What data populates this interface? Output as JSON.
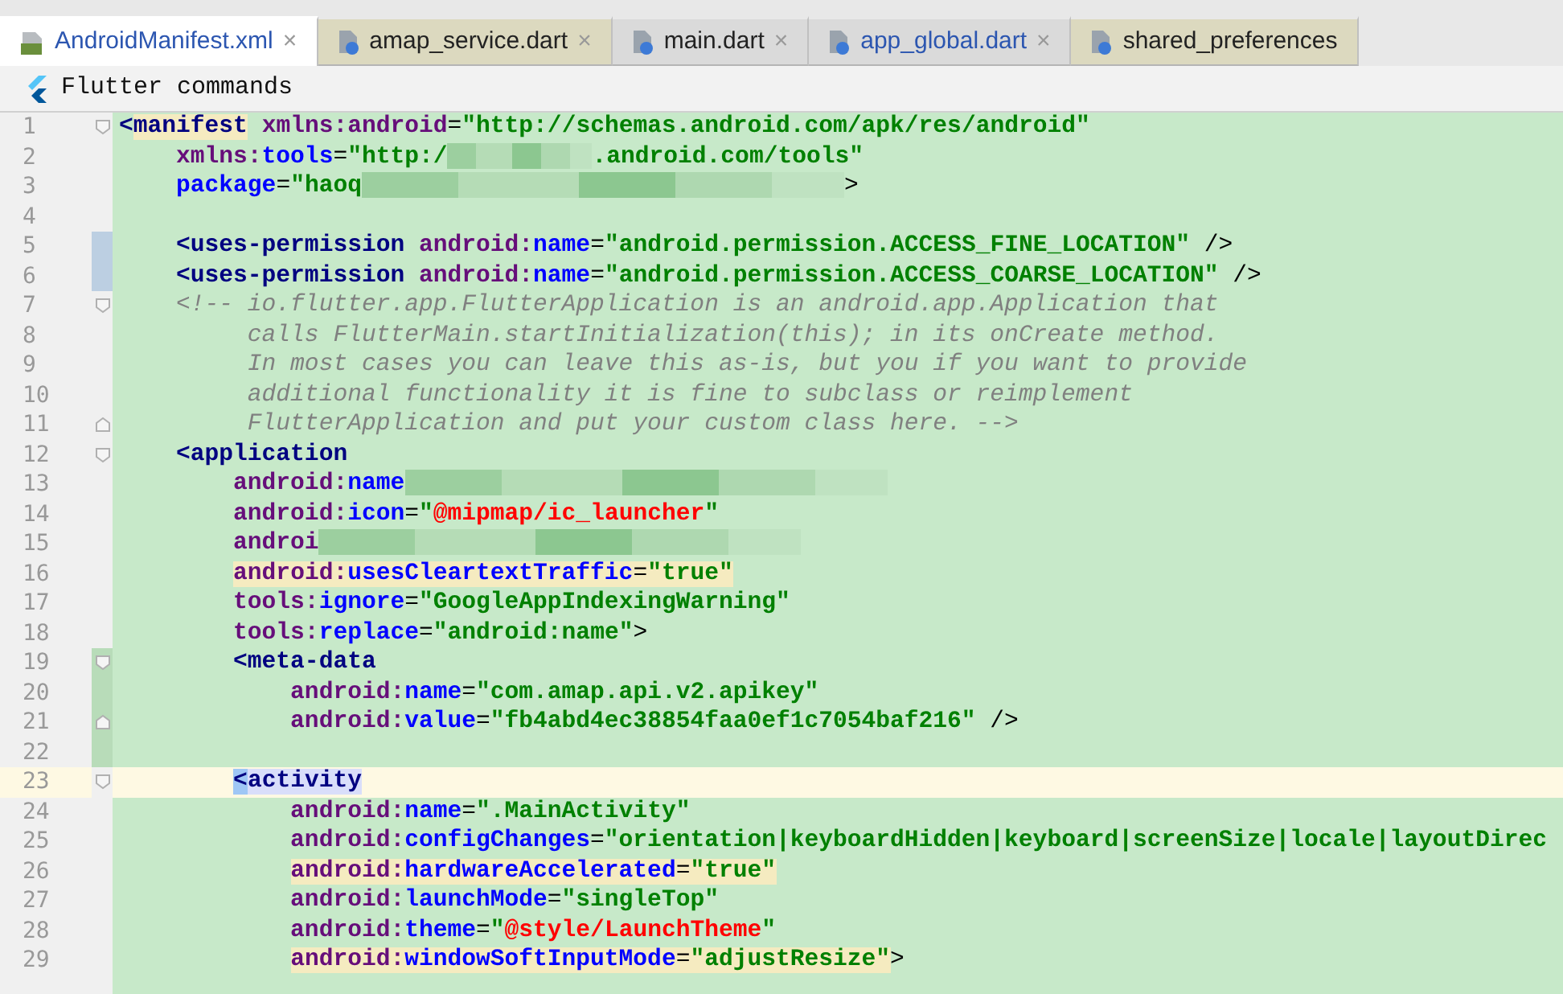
{
  "tabs": [
    {
      "label": "AndroidManifest.xml",
      "selected": true,
      "modified": true,
      "color": "#ffffff",
      "close": "×"
    },
    {
      "label": "amap_service.dart",
      "selected": false,
      "modified": false,
      "color": "#dcd9bf",
      "close": "×"
    },
    {
      "label": "main.dart",
      "selected": false,
      "modified": false,
      "color": "#dadada",
      "close": "×"
    },
    {
      "label": "app_global.dart",
      "selected": false,
      "modified": true,
      "color": "#dadada",
      "close": "×"
    },
    {
      "label": "shared_preferences",
      "selected": false,
      "modified": false,
      "color": "#dcd9bf"
    }
  ],
  "toolbar": {
    "label": "Flutter commands"
  },
  "editor": {
    "lines": [
      {
        "number": "1",
        "fold": {
          "kind": "start"
        },
        "tokens": [
          {
            "t": "<",
            "kind": "tag"
          },
          {
            "kind": "warning",
            "tokens": [
              {
                "t": "manifest",
                "kind": "tag"
              }
            ]
          },
          {
            "t": " xmlns:android",
            "kind": "ns"
          },
          {
            "t": "=",
            "kind": "plain"
          },
          {
            "t": "\"http://schemas.android.com/apk/res/android\"",
            "kind": "str"
          }
        ]
      },
      {
        "number": "2",
        "tokens": [
          {
            "t": "    xmlns:",
            "kind": "ns"
          },
          {
            "t": "tools",
            "kind": "attr"
          },
          {
            "t": "=",
            "kind": "plain"
          },
          {
            "t": "\"http:/",
            "kind": "str"
          },
          {
            "kind": "blurshort"
          },
          {
            "t": ".android.com/tools\"",
            "kind": "str"
          }
        ]
      },
      {
        "number": "3",
        "tokens": [
          {
            "t": "    package",
            "kind": "attr"
          },
          {
            "t": "=",
            "kind": "plain"
          },
          {
            "t": "\"haoq",
            "kind": "str"
          },
          {
            "kind": "blurlong"
          },
          {
            "t": ">",
            "kind": "plain"
          }
        ]
      },
      {
        "number": "4"
      },
      {
        "number": "5",
        "change": {
          "kind": "modified"
        },
        "tokens": [
          {
            "t": "    <uses-permission ",
            "kind": "tag"
          },
          {
            "t": "android:",
            "kind": "ns"
          },
          {
            "t": "name",
            "kind": "attr"
          },
          {
            "t": "=",
            "kind": "plain"
          },
          {
            "t": "\"android.permission.ACCESS_FINE_LOCATION\"",
            "kind": "str"
          },
          {
            "t": " />",
            "kind": "plain"
          }
        ]
      },
      {
        "number": "6",
        "change": {
          "kind": "modified"
        },
        "tokens": [
          {
            "t": "    <uses-permission ",
            "kind": "tag"
          },
          {
            "t": "android:",
            "kind": "ns"
          },
          {
            "t": "name",
            "kind": "attr"
          },
          {
            "t": "=",
            "kind": "plain"
          },
          {
            "t": "\"android.permission.ACCESS_COARSE_LOCATION\"",
            "kind": "str"
          },
          {
            "t": " />",
            "kind": "plain"
          }
        ]
      },
      {
        "number": "7",
        "fold": {
          "kind": "start"
        },
        "tokens": [
          {
            "t": "    <!-- io.flutter.app.FlutterApplication is an android.app.Application that",
            "kind": "comment"
          }
        ]
      },
      {
        "number": "8",
        "tokens": [
          {
            "t": "         calls FlutterMain.startInitialization(this); in its onCreate method.",
            "kind": "comment"
          }
        ]
      },
      {
        "number": "9",
        "tokens": [
          {
            "t": "         In most cases you can leave this as-is, but you if you want to provide",
            "kind": "comment"
          }
        ]
      },
      {
        "number": "10",
        "tokens": [
          {
            "t": "         additional functionality it is fine to subclass or reimplement",
            "kind": "comment"
          }
        ]
      },
      {
        "number": "11",
        "fold": {
          "kind": "end"
        },
        "tokens": [
          {
            "t": "         FlutterApplication and put your custom class here. -->",
            "kind": "comment"
          }
        ]
      },
      {
        "number": "12",
        "fold": {
          "kind": "start"
        },
        "tokens": [
          {
            "t": "    <application",
            "kind": "tag"
          }
        ]
      },
      {
        "number": "13",
        "tokens": [
          {
            "t": "        android:",
            "kind": "ns"
          },
          {
            "t": "name",
            "kind": "attr"
          },
          {
            "kind": "blurlong"
          }
        ]
      },
      {
        "number": "14",
        "tokens": [
          {
            "t": "        android:",
            "kind": "ns"
          },
          {
            "t": "icon",
            "kind": "attr"
          },
          {
            "t": "=",
            "kind": "plain"
          },
          {
            "t": "\"",
            "kind": "str"
          },
          {
            "t": "@mipmap/ic_launcher",
            "kind": "res"
          },
          {
            "t": "\"",
            "kind": "str"
          }
        ]
      },
      {
        "number": "15",
        "tokens": [
          {
            "t": "        androi",
            "kind": "ns"
          },
          {
            "kind": "blurlong"
          }
        ]
      },
      {
        "number": "16",
        "tokens": [
          {
            "kind": "warning",
            "tokens": [
              {
                "t": "        android:",
                "kind": "ns"
              },
              {
                "t": "usesCleartextTraffic",
                "kind": "attr"
              },
              {
                "t": "=",
                "kind": "plain"
              },
              {
                "t": "\"true\"",
                "kind": "str"
              }
            ]
          }
        ]
      },
      {
        "number": "17",
        "tokens": [
          {
            "t": "        tools:",
            "kind": "ns"
          },
          {
            "t": "ignore",
            "kind": "attr"
          },
          {
            "t": "=",
            "kind": "plain"
          },
          {
            "t": "\"GoogleAppIndexingWarning\"",
            "kind": "str"
          }
        ]
      },
      {
        "number": "18",
        "tokens": [
          {
            "t": "        tools:",
            "kind": "ns"
          },
          {
            "t": "replace",
            "kind": "attr"
          },
          {
            "t": "=",
            "kind": "plain"
          },
          {
            "t": "\"android:name\"",
            "kind": "str"
          },
          {
            "t": ">",
            "kind": "plain"
          }
        ]
      },
      {
        "number": "19",
        "fold": {
          "kind": "start"
        },
        "change": {
          "kind": "added"
        },
        "tokens": [
          {
            "t": "        <meta-data",
            "kind": "tag"
          }
        ]
      },
      {
        "number": "20",
        "change": {
          "kind": "added"
        },
        "tokens": [
          {
            "t": "            android:",
            "kind": "ns"
          },
          {
            "t": "name",
            "kind": "attr"
          },
          {
            "t": "=",
            "kind": "plain"
          },
          {
            "t": "\"com.amap.api.v2.apikey\"",
            "kind": "str"
          }
        ]
      },
      {
        "number": "21",
        "fold": {
          "kind": "end"
        },
        "change": {
          "kind": "added"
        },
        "tokens": [
          {
            "t": "            android:",
            "kind": "ns"
          },
          {
            "t": "value",
            "kind": "attr"
          },
          {
            "t": "=",
            "kind": "plain"
          },
          {
            "t": "\"fb4abd4ec38854faa0ef1c7054baf216\"",
            "kind": "str"
          },
          {
            "t": " />",
            "kind": "plain"
          }
        ]
      },
      {
        "number": "22",
        "change": {
          "kind": "added"
        }
      },
      {
        "number": "23",
        "fold": {
          "kind": "start"
        },
        "current": true,
        "tokens": [
          {
            "kind": "brace",
            "tokens": [
              {
                "t": "        <",
                "kind": "tag"
              }
            ]
          },
          {
            "kind": "match",
            "tokens": [
              {
                "t": "activity",
                "kind": "tag"
              }
            ]
          }
        ]
      },
      {
        "number": "24",
        "tokens": [
          {
            "t": "            android:",
            "kind": "ns"
          },
          {
            "t": "name",
            "kind": "attr"
          },
          {
            "t": "=",
            "kind": "plain"
          },
          {
            "t": "\".MainActivity\"",
            "kind": "str"
          }
        ]
      },
      {
        "number": "25",
        "tokens": [
          {
            "t": "            android:",
            "kind": "ns"
          },
          {
            "t": "configChanges",
            "kind": "attr"
          },
          {
            "t": "=",
            "kind": "plain"
          },
          {
            "t": "\"orientation|keyboardHidden|keyboard|screenSize|locale|layoutDirec",
            "kind": "str"
          }
        ]
      },
      {
        "number": "26",
        "tokens": [
          {
            "kind": "warning",
            "tokens": [
              {
                "t": "            android:",
                "kind": "ns"
              },
              {
                "t": "hardwareAccelerated",
                "kind": "attr"
              },
              {
                "t": "=",
                "kind": "plain"
              },
              {
                "t": "\"true\"",
                "kind": "str"
              }
            ]
          }
        ]
      },
      {
        "number": "27",
        "tokens": [
          {
            "t": "            android:",
            "kind": "ns"
          },
          {
            "t": "launchMode",
            "kind": "attr"
          },
          {
            "t": "=",
            "kind": "plain"
          },
          {
            "t": "\"singleTop\"",
            "kind": "str"
          }
        ]
      },
      {
        "number": "28",
        "tokens": [
          {
            "t": "            android:",
            "kind": "ns"
          },
          {
            "t": "theme",
            "kind": "attr"
          },
          {
            "t": "=",
            "kind": "plain"
          },
          {
            "t": "\"",
            "kind": "str"
          },
          {
            "t": "@style/LaunchTheme",
            "kind": "res"
          },
          {
            "t": "\"",
            "kind": "str"
          }
        ]
      },
      {
        "number": "29",
        "tokens": [
          {
            "kind": "warning",
            "tokens": [
              {
                "t": "            android:",
                "kind": "ns"
              },
              {
                "t": "windowSoftInputMode",
                "kind": "attr"
              },
              {
                "t": "=",
                "kind": "plain"
              },
              {
                "t": "\"adjustResize\"",
                "kind": "str"
              }
            ]
          },
          {
            "t": ">",
            "kind": "plain"
          }
        ]
      }
    ]
  }
}
